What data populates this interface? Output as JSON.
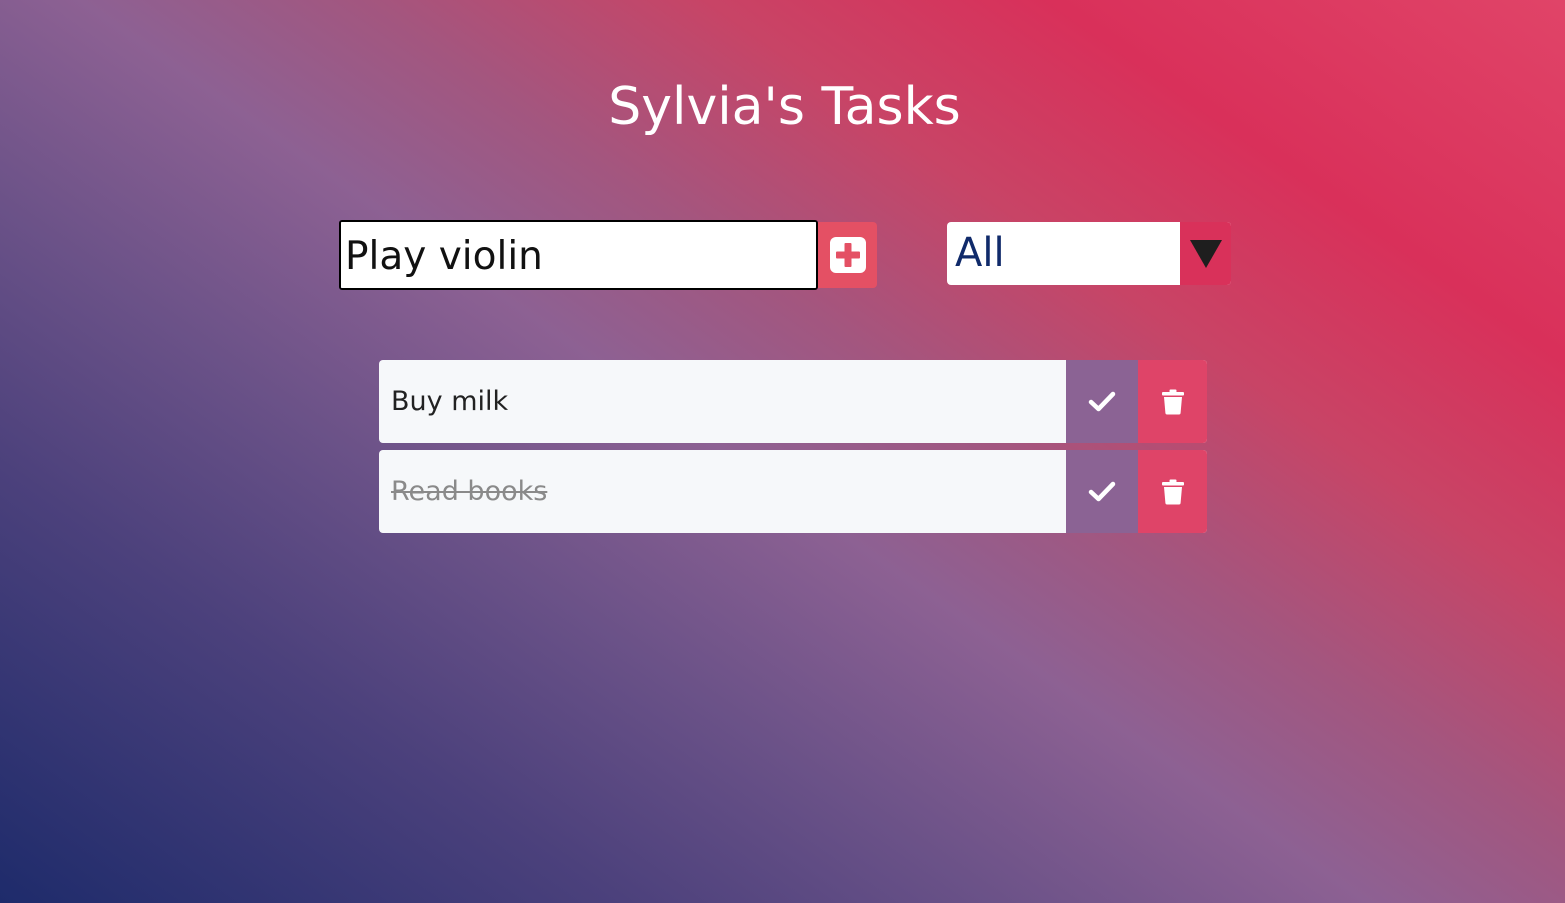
{
  "app": {
    "title": "Sylvia's Tasks"
  },
  "form": {
    "input_value": "Play violin",
    "add_icon": "plus-square-icon"
  },
  "filter": {
    "selected": "All",
    "arrow_icon": "triangle-down-icon"
  },
  "todos": [
    {
      "text": "Buy milk",
      "completed": false
    },
    {
      "text": "Read books",
      "completed": true
    }
  ],
  "colors": {
    "add_button": "#e45064",
    "complete_button": "#8b6394",
    "delete_button": "#df4468",
    "filter_arrow_bg": "#d9315a",
    "filter_text": "#102a6a"
  }
}
